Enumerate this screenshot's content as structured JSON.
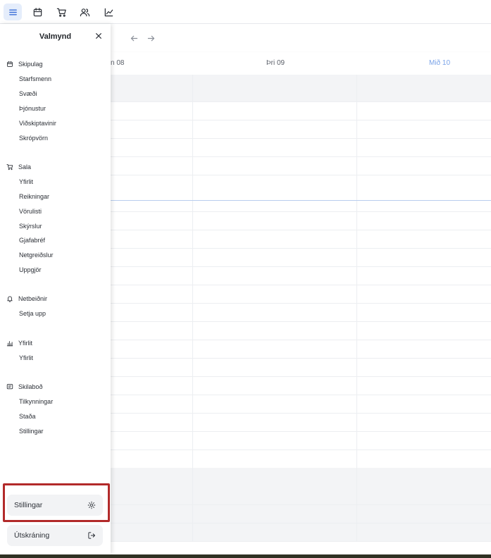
{
  "toolbar": {
    "icons": [
      "menu-icon",
      "calendar-icon",
      "cart-icon",
      "users-icon",
      "chart-icon"
    ],
    "active": "menu-icon",
    "accent_color": "#3b6fd8",
    "active_bg": "#e5edfb"
  },
  "calendar": {
    "days": [
      {
        "label": "n 08"
      },
      {
        "label": "Þri 09"
      },
      {
        "label": "Mið 10"
      }
    ],
    "today_color": "#7aa3e8"
  },
  "sidebar": {
    "title": "Valmynd",
    "sections": [
      {
        "icon": "calendar-icon",
        "label": "Skipulag",
        "items": [
          "Starfsmenn",
          "Svæði",
          "Þjónustur",
          "Viðskiptavinir",
          "Skrópvörn"
        ]
      },
      {
        "icon": "cart-icon",
        "label": "Sala",
        "items": [
          "Yfirlit",
          "Reikningar",
          "Vörulisti",
          "Skýrslur",
          "Gjafabréf",
          "Netgreiðslur",
          "Uppgjör"
        ]
      },
      {
        "icon": "bell-icon",
        "label": "Netbeiðnir",
        "items": [
          "Setja upp"
        ]
      },
      {
        "icon": "bar-chart-icon",
        "label": "Yfirlit",
        "items": [
          "Yfirlit"
        ]
      },
      {
        "icon": "message-icon",
        "label": "Skilaboð",
        "items": [
          "Tilkynningar",
          "Staða",
          "Stillingar"
        ]
      }
    ],
    "settings_button": "Stillingar",
    "logout_button": "Útskráning",
    "highlight_color": "#b22a2a"
  }
}
